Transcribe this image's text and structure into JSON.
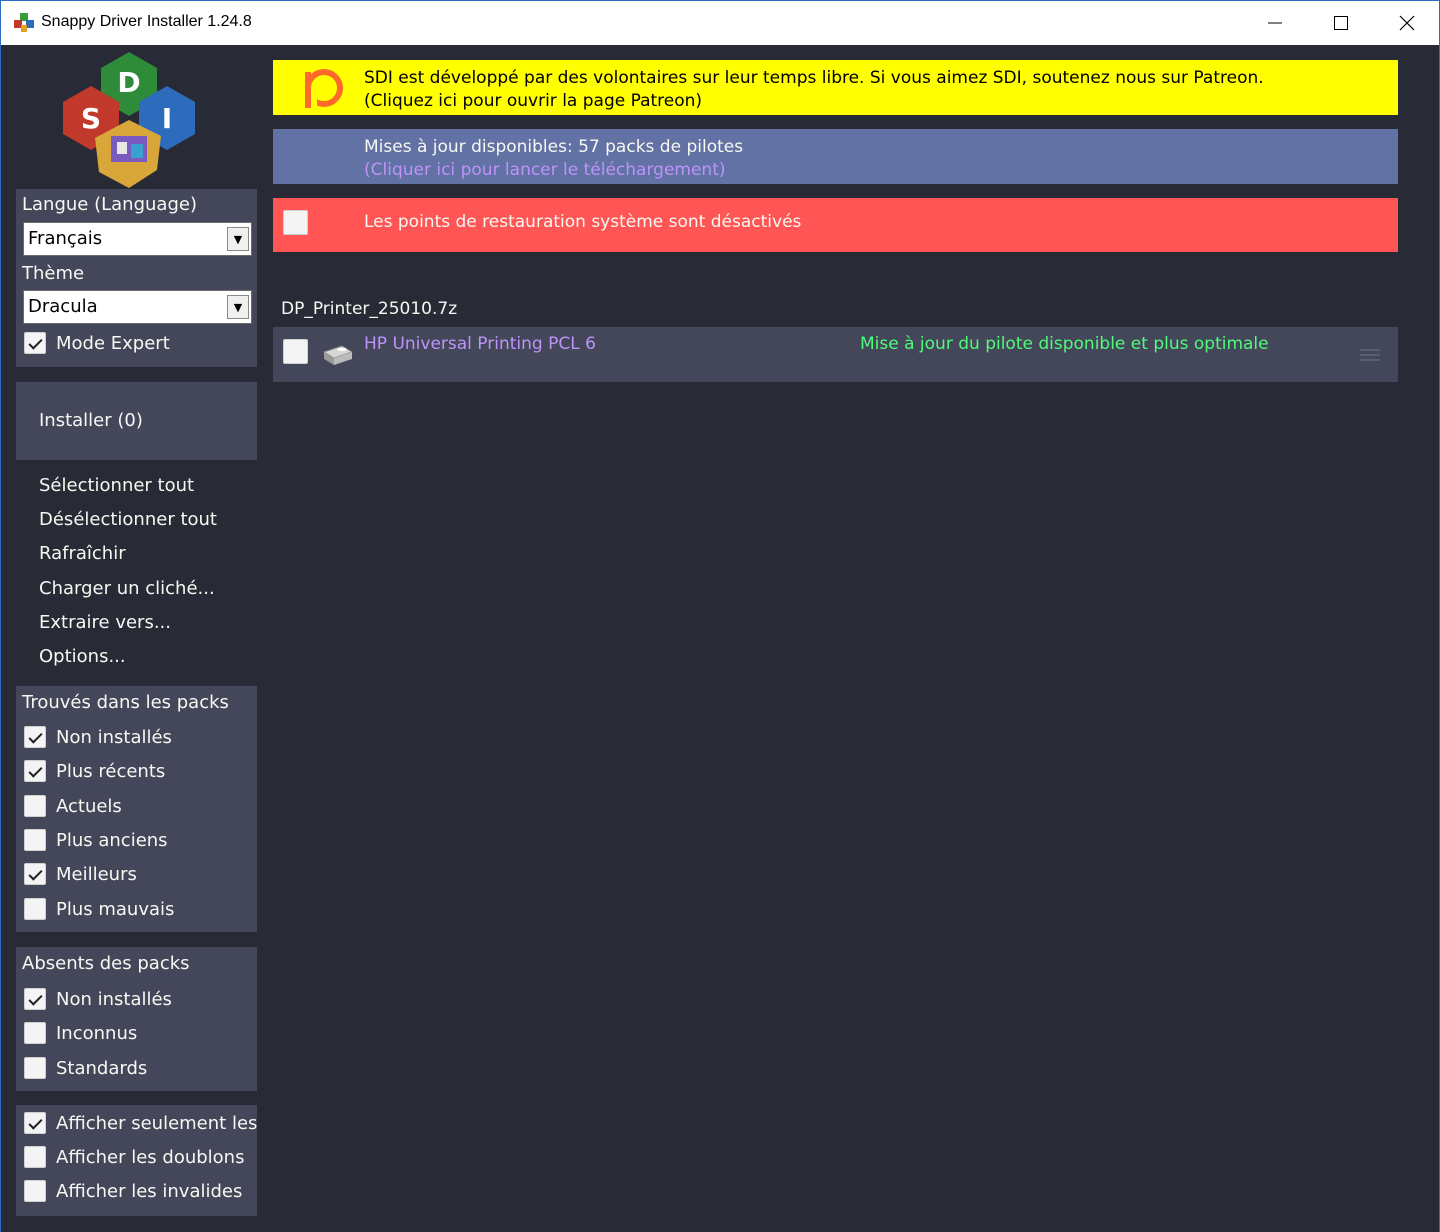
{
  "window": {
    "title": "Snappy Driver Installer 1.24.8"
  },
  "sidebar": {
    "logo_letters": [
      "D",
      "S",
      "I"
    ],
    "language_label": "Langue (Language)",
    "language_value": "Français",
    "theme_label": "Thème",
    "theme_value": "Dracula",
    "expert_mode": {
      "label": "Mode Expert",
      "checked": true
    },
    "install_button": "Installer (0)",
    "actions": [
      "Sélectionner tout",
      "Désélectionner tout",
      "Rafraîchir",
      "Charger un cliché...",
      "Extraire vers...",
      "Options..."
    ],
    "found_group": {
      "title": "Trouvés dans les packs",
      "items": [
        {
          "label": "Non installés",
          "checked": true
        },
        {
          "label": "Plus récents",
          "checked": true
        },
        {
          "label": "Actuels",
          "checked": false
        },
        {
          "label": "Plus anciens",
          "checked": false
        },
        {
          "label": "Meilleurs",
          "checked": true
        },
        {
          "label": "Plus mauvais",
          "checked": false
        }
      ]
    },
    "absent_group": {
      "title": "Absents des packs",
      "items": [
        {
          "label": "Non installés",
          "checked": true
        },
        {
          "label": "Inconnus",
          "checked": false
        },
        {
          "label": "Standards",
          "checked": false
        }
      ]
    },
    "display_group": {
      "items": [
        {
          "label": "Afficher seulement les",
          "checked": true
        },
        {
          "label": "Afficher les doublons",
          "checked": false
        },
        {
          "label": "Afficher les invalides",
          "checked": false
        }
      ]
    }
  },
  "banners": {
    "patreon": {
      "line1": "SDI est développé par des volontaires sur leur temps libre. Si vous aimez SDI, soutenez nous sur Patreon.",
      "line2": "(Cliquez ici pour ouvrir la page Patreon)",
      "color": "#ffff00"
    },
    "updates": {
      "line1": "Mises à jour disponibles: 57 packs de pilotes",
      "line2": "(Cliquer ici pour lancer le téléchargement)",
      "color": "#6272a4"
    },
    "restore": {
      "text": "Les points de restauration système sont désactivés",
      "color": "#ff5555"
    }
  },
  "pack": {
    "title": "DP_Printer_25010.7z",
    "drivers": [
      {
        "name": "HP Universal Printing PCL 6",
        "status": "Mise à jour du pilote disponible et plus optimale",
        "checked": false,
        "icon": "printer-icon"
      }
    ]
  },
  "colors": {
    "background": "#282a36",
    "panel": "#44475a",
    "text": "#f8f8f2",
    "purple": "#bd93f9",
    "green": "#50fa7b"
  }
}
